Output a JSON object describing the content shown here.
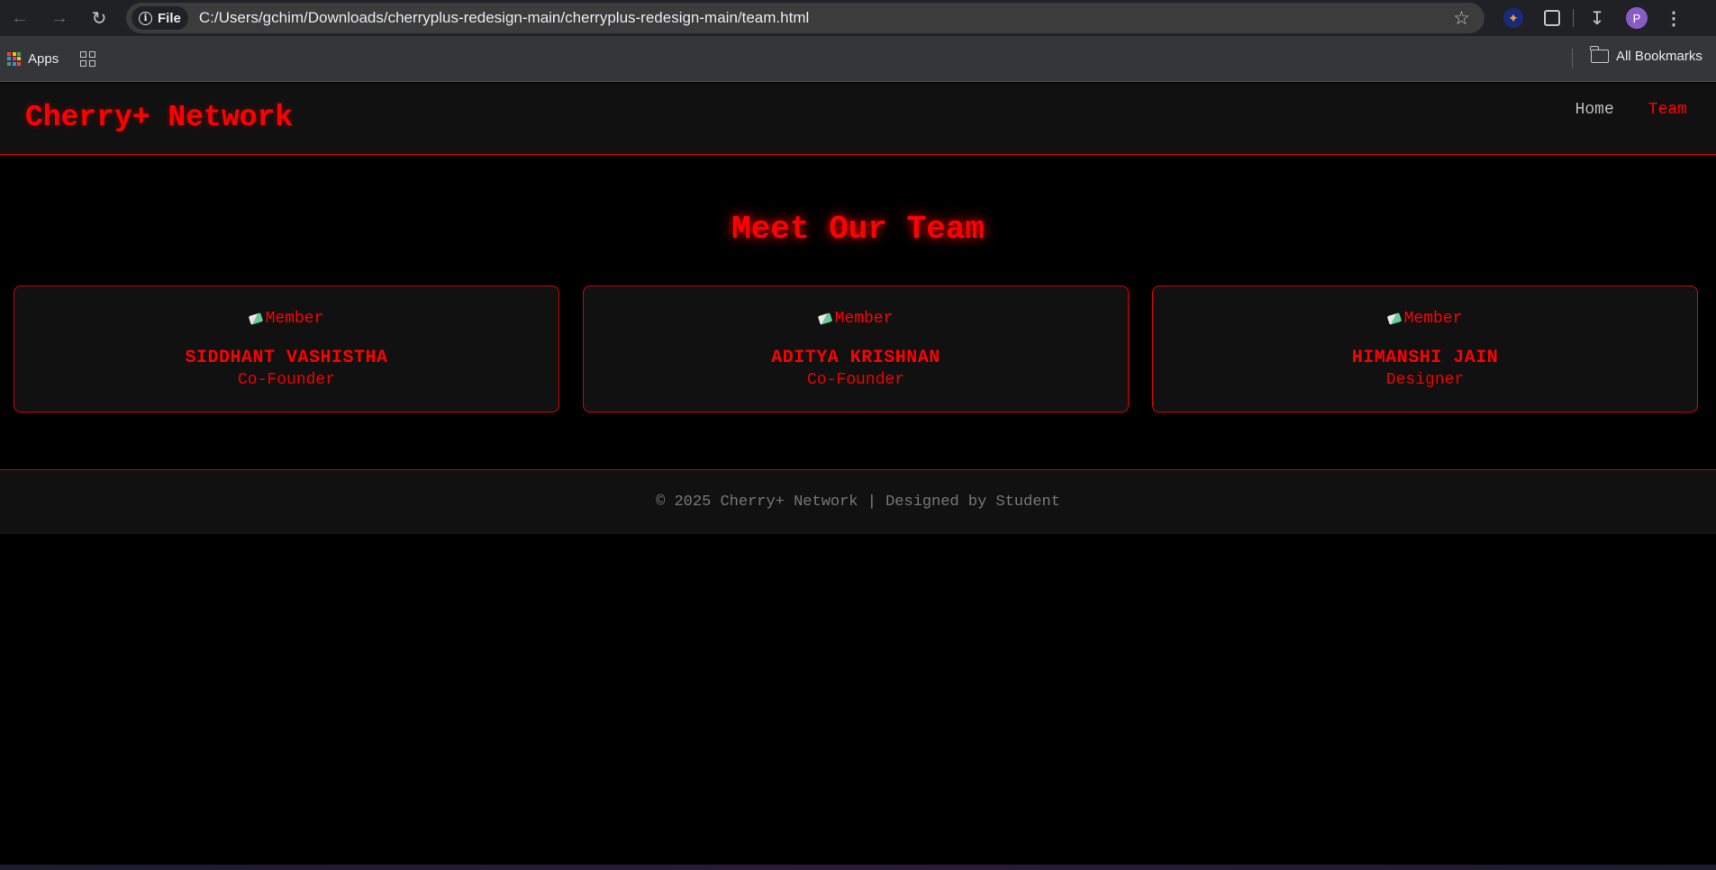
{
  "browser": {
    "chip_label": "File",
    "url": "C:/Users/gchim/Downloads/cherryplus-redesign-main/cherryplus-redesign-main/team.html",
    "profile_initial": "P",
    "bookmarks": {
      "apps_label": "Apps",
      "all_bookmarks_label": "All Bookmarks"
    },
    "icons": [
      "back-arrow-icon",
      "forward-arrow-icon",
      "reload-icon",
      "info-icon",
      "star-icon",
      "extension-logo-icon",
      "puzzle-icon",
      "download-icon",
      "kebab-menu-icon",
      "apps-grid-icon",
      "tab-groups-icon",
      "folder-icon"
    ]
  },
  "site": {
    "logo": "Cherry+ Network",
    "nav": [
      {
        "label": "Home",
        "active": false
      },
      {
        "label": "Team",
        "active": true
      }
    ],
    "heading": "Meet Our Team",
    "members": [
      {
        "img_alt": "Member",
        "name": "SIDDHANT VASHISTHA",
        "role": "Co-Founder"
      },
      {
        "img_alt": "Member",
        "name": "ADITYA KRISHNAN",
        "role": "Co-Founder"
      },
      {
        "img_alt": "Member",
        "name": "HIMANSHI JAIN",
        "role": "Designer"
      }
    ],
    "footer": "© 2025 Cherry+ Network | Designed by Student"
  },
  "colors": {
    "accent": "#ff0000",
    "header_bg": "#111111",
    "page_bg": "#000000",
    "footer_text": "#777777"
  }
}
